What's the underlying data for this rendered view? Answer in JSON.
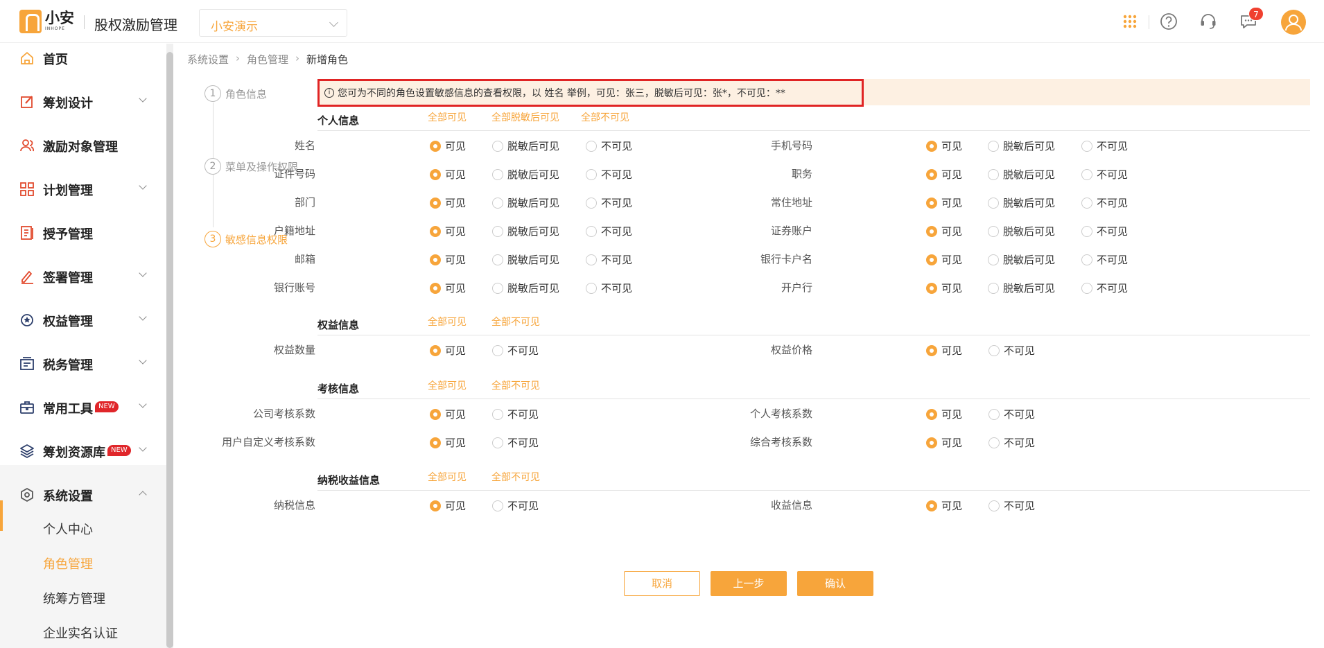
{
  "header": {
    "logo_cn": "小安",
    "logo_en": "INHOPE",
    "app_title": "股权激励管理",
    "company": "小安演示",
    "message_count": "7"
  },
  "sidebar": {
    "items": [
      {
        "label": "首页",
        "icon": "home-icon"
      },
      {
        "label": "筹划设计",
        "icon": "edit-icon"
      },
      {
        "label": "激励对象管理",
        "icon": "users-icon"
      },
      {
        "label": "计划管理",
        "icon": "grid-icon"
      },
      {
        "label": "授予管理",
        "icon": "book-icon"
      },
      {
        "label": "签署管理",
        "icon": "sign-icon"
      },
      {
        "label": "权益管理",
        "icon": "medal-icon"
      },
      {
        "label": "税务管理",
        "icon": "tax-icon"
      },
      {
        "label": "常用工具",
        "icon": "toolbox-icon",
        "tag": "NEW"
      },
      {
        "label": "筹划资源库",
        "icon": "layers-icon",
        "tag": "NEW"
      },
      {
        "label": "系统设置",
        "icon": "settings-icon"
      }
    ],
    "subitems": [
      "个人中心",
      "角色管理",
      "统筹方管理",
      "企业实名认证"
    ]
  },
  "breadcrumb": [
    "系统设置",
    "角色管理",
    "新增角色"
  ],
  "steps": [
    {
      "num": "1",
      "label": "角色信息"
    },
    {
      "num": "2",
      "label": "菜单及操作权限"
    },
    {
      "num": "3",
      "label": "敏感信息权限"
    }
  ],
  "notice": "您可为不同的角色设置敏感信息的查看权限，以 姓名 举例，可见：张三，脱敏后可见：张*，不可见：**",
  "options": {
    "visible": "可见",
    "masked": "脱敏后可见",
    "hidden": "不可见"
  },
  "sections": {
    "personal": {
      "title": "个人信息",
      "links": [
        "全部可见",
        "全部脱敏后可见",
        "全部不可见"
      ],
      "left": [
        "姓名",
        "证件号码",
        "部门",
        "户籍地址",
        "邮箱",
        "银行账号"
      ],
      "right": [
        "手机号码",
        "职务",
        "常住地址",
        "证券账户",
        "银行卡户名",
        "开户行"
      ]
    },
    "equity": {
      "title": "权益信息",
      "links": [
        "全部可见",
        "全部不可见"
      ],
      "left": [
        "权益数量"
      ],
      "right": [
        "权益价格"
      ]
    },
    "assessment": {
      "title": "考核信息",
      "links": [
        "全部可见",
        "全部不可见"
      ],
      "left": [
        "公司考核系数",
        "用户自定义考核系数"
      ],
      "right": [
        "个人考核系数",
        "综合考核系数"
      ]
    },
    "tax": {
      "title": "纳税收益信息",
      "links": [
        "全部可见",
        "全部不可见"
      ],
      "left": [
        "纳税信息"
      ],
      "right": [
        "收益信息"
      ]
    }
  },
  "buttons": {
    "cancel": "取消",
    "prev": "上一步",
    "confirm": "确认"
  },
  "colors": {
    "accent": "#f7a53b",
    "notice_bg": "#fdf0e2",
    "highlight": "#e02424",
    "badge": "#f0402f"
  }
}
